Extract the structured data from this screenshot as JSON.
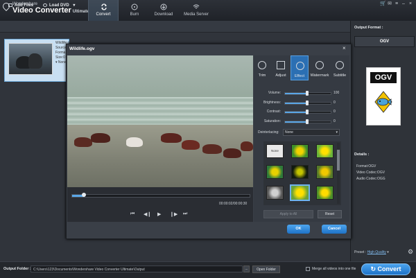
{
  "app": {
    "brand_small": "Wondershare",
    "brand_large": "Video Converter",
    "brand_edition": "Ultimate"
  },
  "nav": {
    "tabs": [
      {
        "label": "Convert"
      },
      {
        "label": "Burn"
      },
      {
        "label": "Download"
      },
      {
        "label": "Media Server"
      }
    ],
    "active": "Convert"
  },
  "toolbar": {
    "add_files": "Add Files",
    "load_dvd": "Load DVD"
  },
  "file_item": {
    "name": "Wildlife.o",
    "line2": "Source:",
    "line3": "Forma",
    "line4": "Size:0",
    "info": "None"
  },
  "right_panel": {
    "output_format_label": "Output Format :",
    "format_value": "OGV",
    "format_icon_text": "OGV",
    "details_label": "Details :",
    "details": [
      "Format:OGV",
      "Video Codec:OGV",
      "Audio Codec:OGG"
    ],
    "preset_label": "Preset :",
    "preset_value": "High Quality"
  },
  "bottom": {
    "output_folder_label": "Output Folder :",
    "output_folder_path": "C:\\Users\\123\\Documents\\Wondershare Video Converter Ultimate\\Output",
    "browse": "...",
    "open_folder": "Open Folder",
    "merge_label": "Merge all videos into one file",
    "convert": "Convert"
  },
  "dialog": {
    "title": "Wildlife.ogv",
    "close": "×",
    "time": "00:00:02/00:00:30",
    "playback_progress": 0.07,
    "tabs": [
      {
        "label": "Trim"
      },
      {
        "label": "Adjust"
      },
      {
        "label": "Effect"
      },
      {
        "label": "Watermark"
      },
      {
        "label": "Subtitle"
      }
    ],
    "active_tab": "Effect",
    "sliders": [
      {
        "label": "Volume:",
        "value": "100"
      },
      {
        "label": "Brightness:",
        "value": "0"
      },
      {
        "label": "Contrast:",
        "value": "0"
      },
      {
        "label": "Saturation:",
        "value": "0"
      }
    ],
    "deinterlacing_label": "Deinterlacing:",
    "deinterlacing_value": "None",
    "first_filter_label": "None",
    "apply_to_all": "Apply to All",
    "reset": "Reset",
    "ok": "OK",
    "cancel": "Cancel"
  },
  "colors": {
    "accent": "#2b6fb3",
    "button_blue": "#1e72c6",
    "panel": "#353a42"
  }
}
